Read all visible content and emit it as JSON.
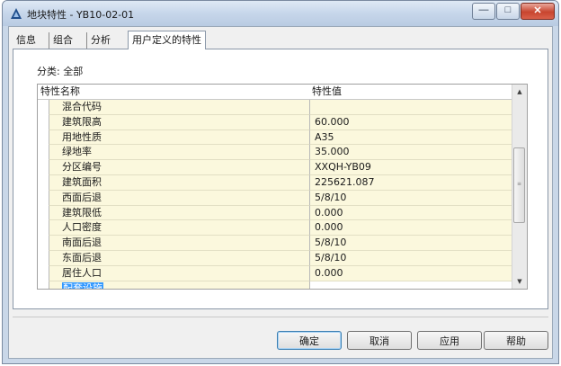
{
  "window": {
    "title": "地块特性 - YB10-02-01",
    "minimize_glyph": "—",
    "maximize_glyph": "□",
    "close_glyph": "✕"
  },
  "tabs": [
    {
      "label": "信息"
    },
    {
      "label": "组合"
    },
    {
      "label": "分析"
    },
    {
      "label": "用户定义的特性"
    }
  ],
  "category_label": "分类: 全部",
  "grid": {
    "columns": {
      "name": "特性名称",
      "value": "特性值"
    },
    "rows": [
      {
        "name": "混合代码",
        "value": ""
      },
      {
        "name": "建筑限高",
        "value": "60.000"
      },
      {
        "name": "用地性质",
        "value": "A35"
      },
      {
        "name": "绿地率",
        "value": "35.000"
      },
      {
        "name": "分区编号",
        "value": "XXQH-YB09"
      },
      {
        "name": "建筑面积",
        "value": "225621.087"
      },
      {
        "name": "西面后退",
        "value": "5/8/10"
      },
      {
        "name": "建筑限低",
        "value": "0.000"
      },
      {
        "name": "人口密度",
        "value": "0.000"
      },
      {
        "name": "南面后退",
        "value": "5/8/10"
      },
      {
        "name": "东面后退",
        "value": "5/8/10"
      },
      {
        "name": "居住人口",
        "value": "0.000"
      },
      {
        "name": "配套设施",
        "value": ""
      }
    ],
    "scroll_up_glyph": "▲",
    "scroll_down_glyph": "▼",
    "scroll_grip": "≡"
  },
  "buttons": {
    "ok": "确定",
    "cancel": "取消",
    "apply": "应用",
    "help": "帮助"
  }
}
